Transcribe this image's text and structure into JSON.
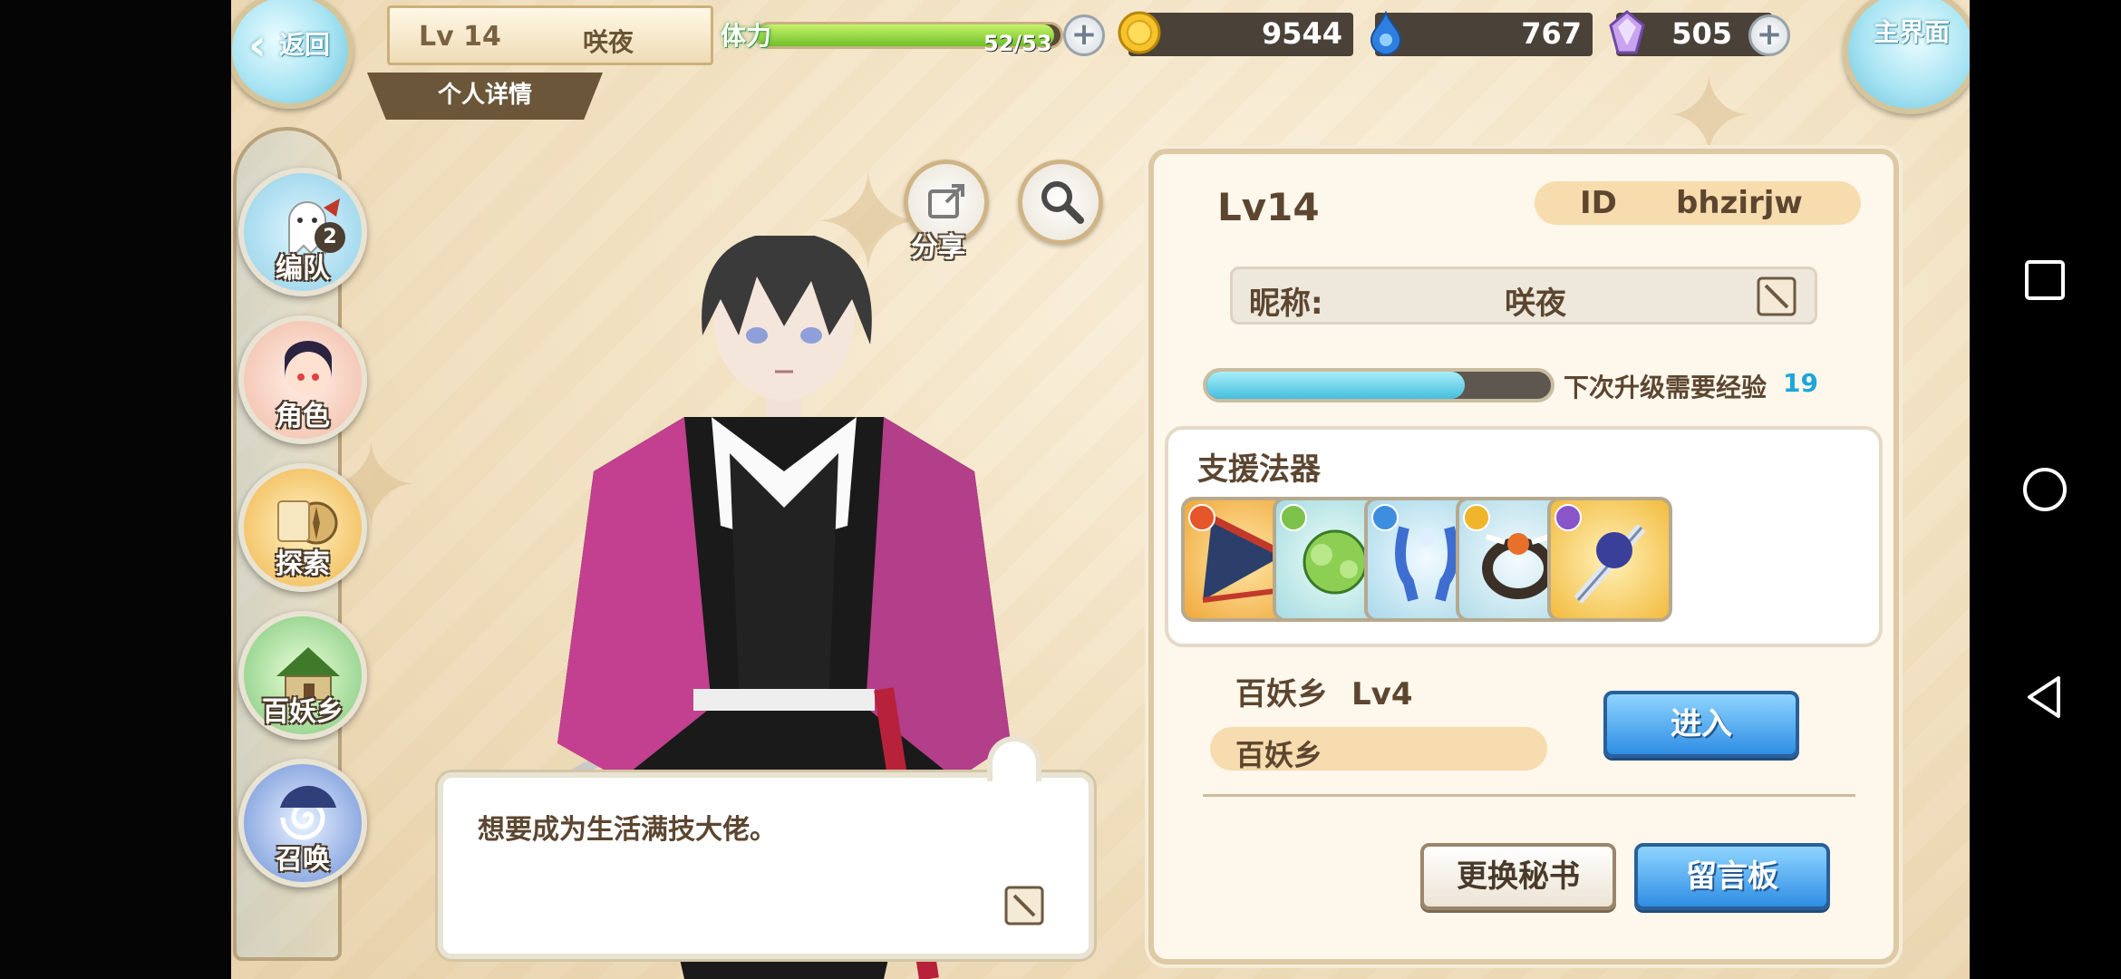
{
  "topbar": {
    "back_label": "返回",
    "level": "Lv 14",
    "player_name": "咲夜",
    "tab_label": "个人详情",
    "stamina_label": "体力",
    "stamina_value": "52/53",
    "stamina_fraction": 0.98,
    "gold": "9544",
    "water": "767",
    "crystal": "505",
    "home_label": "主界面"
  },
  "leftnav": {
    "items": [
      {
        "label": "编队",
        "badge": "2"
      },
      {
        "label": "角色"
      },
      {
        "label": "探索"
      },
      {
        "label": "百妖乡"
      },
      {
        "label": "召唤"
      }
    ]
  },
  "center": {
    "share_label": "分享",
    "speech_text": "想要成为生活满技大佬。"
  },
  "panel": {
    "level": "Lv14",
    "id_key": "ID",
    "id_value": "bhzirjw",
    "nickname_key": "昵称:",
    "nickname_value": "咲夜",
    "exp_label": "下次升级需要经验",
    "exp_value": "19",
    "exp_fraction": 0.75,
    "support_title": "支援法器",
    "support_items": [
      {
        "name": "fan-artifact",
        "element_color": "#e5562a",
        "star": false
      },
      {
        "name": "herb-artifact",
        "element_color": "#7cc24a",
        "star": false
      },
      {
        "name": "tassel-artifact",
        "element_color": "#3e8ee0",
        "star": true
      },
      {
        "name": "ring-artifact",
        "element_color": "#f0b52a",
        "star": false
      },
      {
        "name": "sword-artifact",
        "element_color": "#8a55c9",
        "star": false
      }
    ],
    "village_name": "百妖乡",
    "village_level": "Lv4",
    "village_bar_label": "百妖乡",
    "enter_button": "进入",
    "change_secretary_button": "更换秘书",
    "message_board_button": "留言板"
  },
  "colors": {
    "background": "#f3e3c4",
    "panel": "#fdf7ec",
    "text": "#5c4630",
    "blue_button": "#2f8ee4",
    "exp_value": "#1ea6d9"
  }
}
